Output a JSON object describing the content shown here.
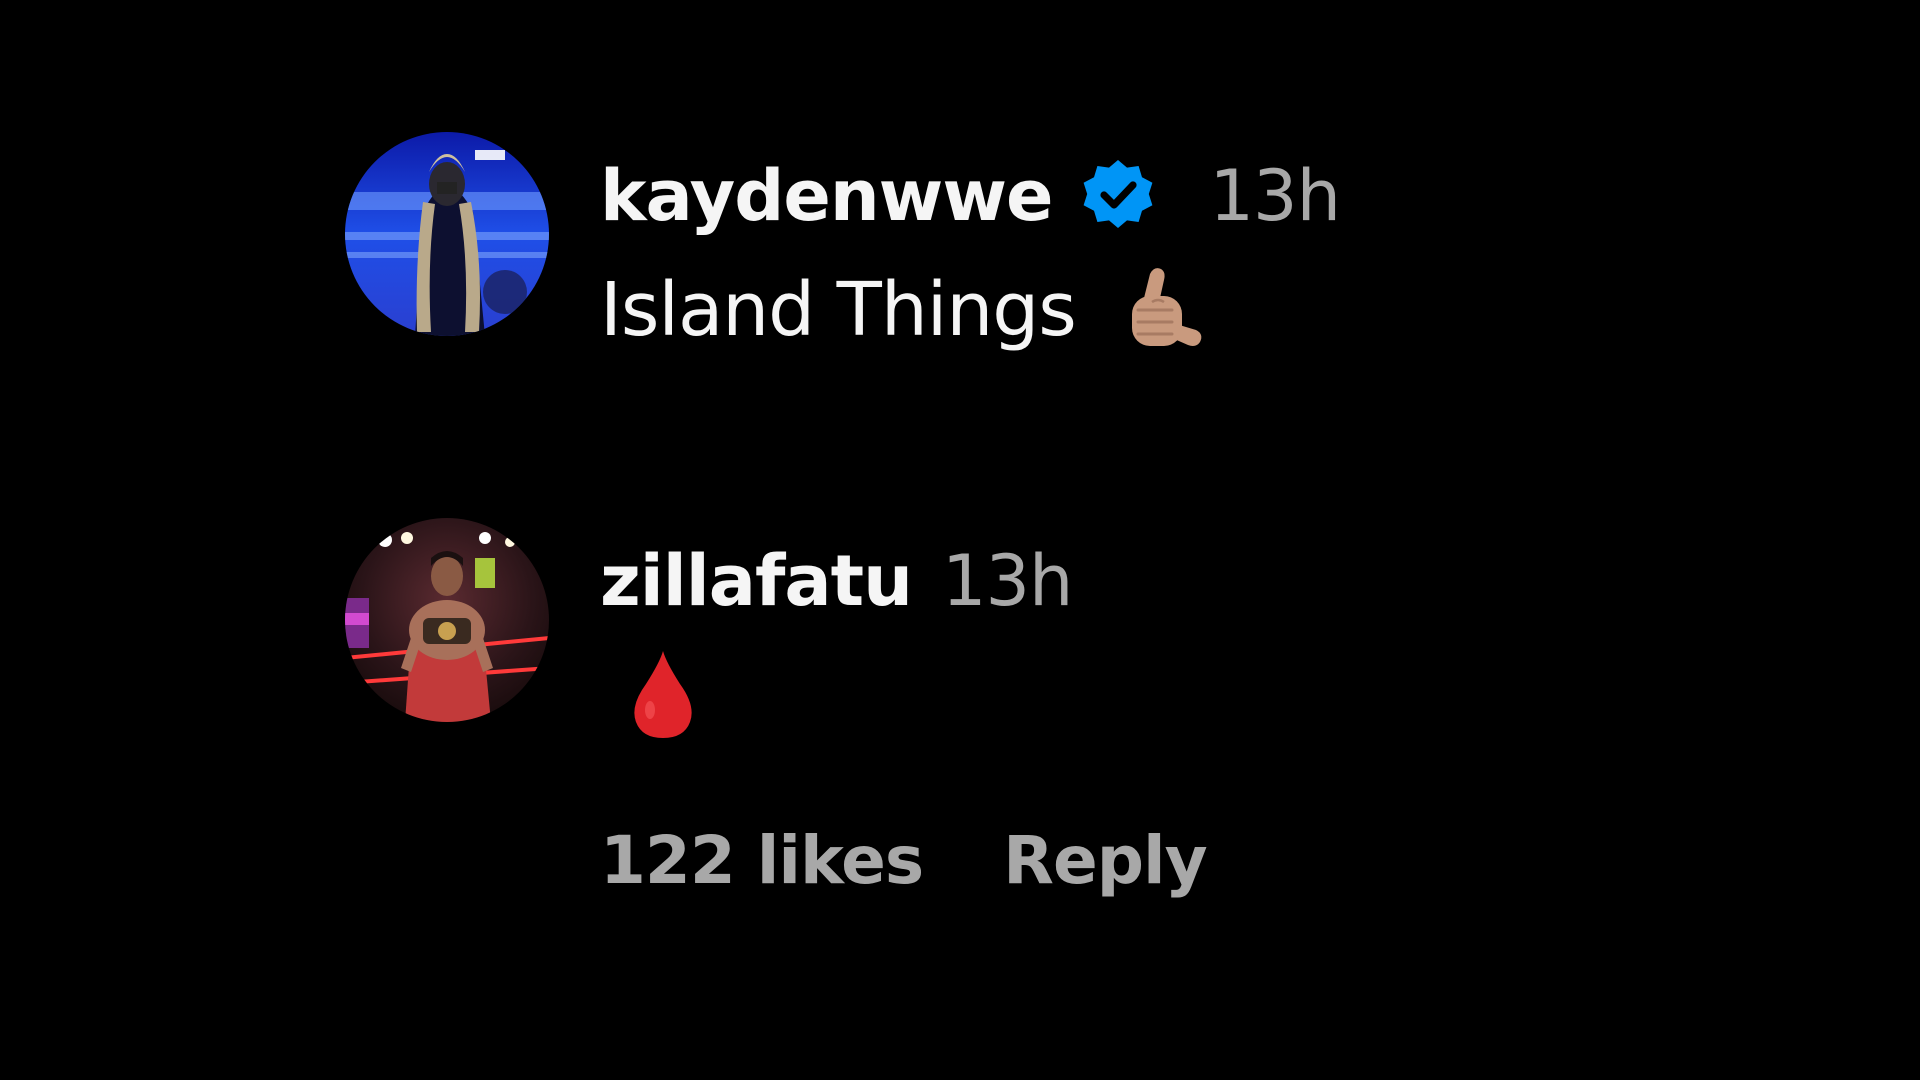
{
  "comments": [
    {
      "username": "kaydenwwe",
      "verified": true,
      "time": "13h",
      "text": "Island Things",
      "emoji": "call-me-hand-medium-skin"
    },
    {
      "username": "zillafatu",
      "verified": false,
      "time": "13h",
      "text": "",
      "emoji": "blood-drop"
    }
  ],
  "actions": {
    "likes": "122 likes",
    "reply": "Reply"
  },
  "colors": {
    "background": "#000000",
    "primary_text": "#f5f5f5",
    "secondary_text": "#a8a8a8",
    "verified_badge": "#0095f6",
    "drop": "#e0242a"
  }
}
